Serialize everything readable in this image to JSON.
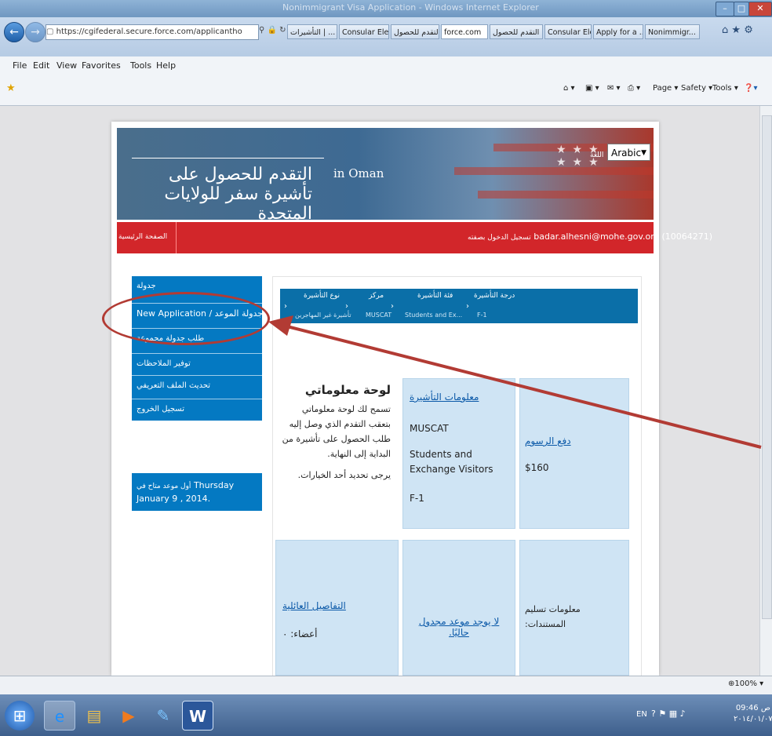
{
  "browser": {
    "window_title": "Nonimmigrant Visa Application - Windows Internet Explorer",
    "address": "https://cgifederal.secure.force.com/applicantho",
    "tabs": [
      {
        "label": "التأشيرات | ..."
      },
      {
        "label": "Consular Ele..."
      },
      {
        "label": "التقدم للحصول ..."
      },
      {
        "label": "force.com"
      },
      {
        "label": "التقدم للحصول ..."
      },
      {
        "label": "Consular Ele..."
      },
      {
        "label": "Apply for a ..."
      },
      {
        "label": "Nonimmigr..."
      }
    ],
    "menu": [
      "File",
      "Edit",
      "View",
      "Favorites",
      "Tools",
      "Help"
    ],
    "commands": {
      "page": "Page ▾",
      "safety": "Safety ▾",
      "tools": "Tools ▾"
    },
    "zoom": "100%"
  },
  "header": {
    "title": "التقدم للحصول على تأشيرة سفر للولايات المتحدة",
    "country": "in Oman",
    "language_label": "اللغة",
    "language_value": "Arabic"
  },
  "redbar": {
    "home": "الصفحة الرئيسية",
    "login_label": "تسجيل الدخول بصفته",
    "user": "badar.alhesni@mohe.gov.om (10064271)"
  },
  "sidebar": {
    "items": [
      {
        "label": "جدولة"
      },
      {
        "label": "New Application / جدولة الموعد"
      },
      {
        "label": "طلب جدولة مجموعة"
      },
      {
        "label": "توفير الملاحظات"
      },
      {
        "label": "تحديث الملف التعريفي"
      },
      {
        "label": "تسجيل الخروج"
      }
    ],
    "appointment": {
      "label": "أول موعد متاح في",
      "date": "Thursday January 9 , 2014."
    }
  },
  "breadcrumb": [
    {
      "label": "درجة التأشيرة",
      "value": "F-1"
    },
    {
      "label": "فئة التأشيرة",
      "value": "Students and Ex..."
    },
    {
      "label": "مركز",
      "value": "MUSCAT"
    },
    {
      "label": "نوع التأشيرة",
      "value": "تأشيرة غير المهاجرين"
    }
  ],
  "dashboard": {
    "title": "لوحة معلوماتي",
    "description": "تسمح لك لوحة معلوماتي بتعقب التقدم الذي وصل إليه طلب الحصول على تأشيرة من البداية إلى النهاية.",
    "instruction": "يرجى تحديد أحد الخيارات."
  },
  "visa_info": {
    "title": "معلومات التأشيرة",
    "center": "MUSCAT",
    "category": "Students and Exchange Visitors",
    "class": "F-1"
  },
  "fees": {
    "title": "دفع الرسوم",
    "amount": "$160"
  },
  "family": {
    "title": "التفاصيل العائلية",
    "members": "أعضاء: ٠"
  },
  "appointment_card": {
    "text": "لا يوجد موعد مجدول حاليًا."
  },
  "documents": {
    "text": "معلومات تسليم المستندات:"
  },
  "taskbar": {
    "lang": "EN",
    "time": "09:46 ص",
    "date": "٢٠١٤/٠١/٠٧"
  },
  "colors": {
    "accent_blue": "#0479c2",
    "red_bar": "#d2262a",
    "annotation": "#b23b34"
  }
}
